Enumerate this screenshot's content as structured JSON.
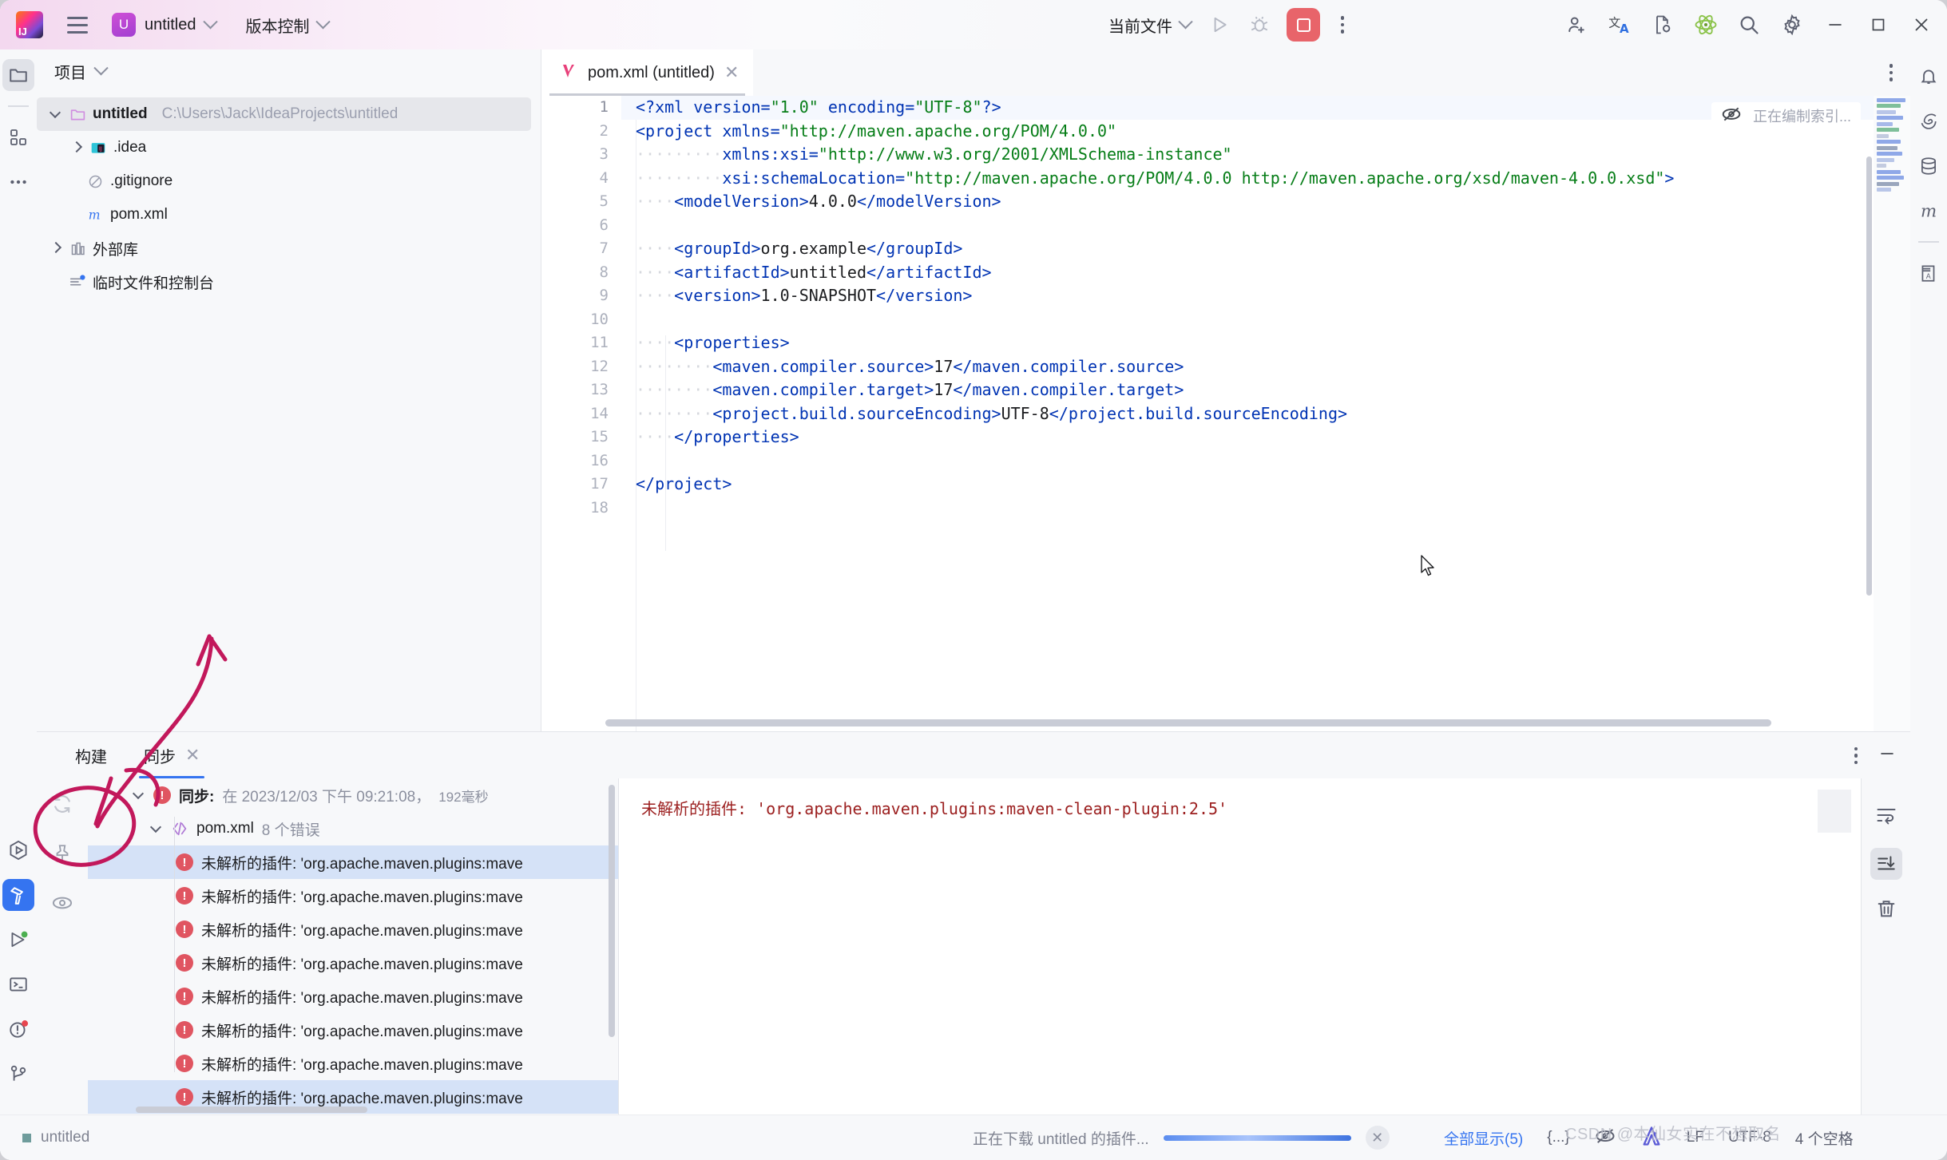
{
  "window": {
    "app_icon": "intellij-idea-logo",
    "menu_icon": "hamburger-menu-icon",
    "project_badge": "U",
    "project_name": "untitled",
    "vcs_label": "版本控制",
    "run_config": "当前文件",
    "minimize_label": "−",
    "maximize_label": "▢",
    "close_label": "✕"
  },
  "toolbar_right_icons": [
    "add-user-icon",
    "translate-icon",
    "file-settings-icon",
    "atom-plugin-icon",
    "search-icon",
    "settings-gear-icon"
  ],
  "left_activity_bar": {
    "top_items": [
      "project-folder-icon",
      "structure-icon",
      "more-icon"
    ],
    "bottom_items": [
      "run-icon",
      "build-hammer-icon",
      "run-dashboard-icon",
      "terminal-icon",
      "problems-icon",
      "git-branch-icon"
    ]
  },
  "right_activity_bar": {
    "items": [
      "notifications-bell-icon",
      "ai-assistant-icon",
      "database-icon",
      "maven-icon",
      "dictionary-icon"
    ]
  },
  "project_panel": {
    "title": "项目",
    "tree": [
      {
        "label": "untitled",
        "path": "C:\\Users\\Jack\\IdeaProjects\\untitled",
        "icon": "folder-icon",
        "state": "expanded",
        "selected": true,
        "indent": 0
      },
      {
        "label": ".idea",
        "path": "",
        "icon": "idea-folder-icon",
        "state": "collapsed",
        "selected": false,
        "indent": 1
      },
      {
        "label": ".gitignore",
        "path": "",
        "icon": "gitignore-icon",
        "state": "leaf",
        "selected": false,
        "indent": 1
      },
      {
        "label": "pom.xml",
        "path": "",
        "icon": "maven-file-icon",
        "state": "leaf",
        "selected": false,
        "indent": 1
      },
      {
        "label": "外部库",
        "path": "",
        "icon": "external-libraries-icon",
        "state": "collapsed",
        "selected": false,
        "indent": 0
      },
      {
        "label": "临时文件和控制台",
        "path": "",
        "icon": "scratches-icon",
        "state": "leaf",
        "selected": false,
        "indent": 0
      }
    ]
  },
  "editor": {
    "tab_label": "pom.xml (untitled)",
    "tab_icon": "maven-v-icon",
    "tab_close": "✕",
    "indexing_text": "正在编制索引...",
    "indexing_icon": "inspections-off-icon",
    "lines": [
      {
        "n": 1,
        "current": true,
        "tokens": [
          {
            "t": "tag",
            "s": "<?xml "
          },
          {
            "t": "attr",
            "s": "version"
          },
          {
            "t": "tag",
            "s": "="
          },
          {
            "t": "val",
            "s": "\"1.0\""
          },
          {
            "t": "txt",
            "s": " "
          },
          {
            "t": "attr",
            "s": "encoding"
          },
          {
            "t": "tag",
            "s": "="
          },
          {
            "t": "val",
            "s": "\"UTF-8\""
          },
          {
            "t": "tag",
            "s": "?>"
          }
        ]
      },
      {
        "n": 2,
        "current": false,
        "tokens": [
          {
            "t": "tag",
            "s": "<project "
          },
          {
            "t": "attr",
            "s": "xmlns"
          },
          {
            "t": "tag",
            "s": "="
          },
          {
            "t": "val",
            "s": "\"http://maven.apache.org/POM/4.0.0\""
          }
        ]
      },
      {
        "n": 3,
        "current": false,
        "tokens": [
          {
            "t": "dot",
            "s": "·········"
          },
          {
            "t": "attr",
            "s": "xmlns:xsi"
          },
          {
            "t": "tag",
            "s": "="
          },
          {
            "t": "val",
            "s": "\"http://www.w3.org/2001/XMLSchema-instance\""
          }
        ]
      },
      {
        "n": 4,
        "current": false,
        "tokens": [
          {
            "t": "dot",
            "s": "·········"
          },
          {
            "t": "attr",
            "s": "xsi:schemaLocation"
          },
          {
            "t": "tag",
            "s": "="
          },
          {
            "t": "val",
            "s": "\"http://maven.apache.org/POM/4.0.0 http://maven.apache.org/xsd/maven-4.0.0.xsd\""
          },
          {
            "t": "tag",
            "s": ">"
          }
        ]
      },
      {
        "n": 5,
        "current": false,
        "tokens": [
          {
            "t": "dot",
            "s": "····"
          },
          {
            "t": "tag",
            "s": "<modelVersion>"
          },
          {
            "t": "txt",
            "s": "4.0.0"
          },
          {
            "t": "tag",
            "s": "</modelVersion>"
          }
        ]
      },
      {
        "n": 6,
        "current": false,
        "tokens": []
      },
      {
        "n": 7,
        "current": false,
        "tokens": [
          {
            "t": "dot",
            "s": "····"
          },
          {
            "t": "tag",
            "s": "<groupId>"
          },
          {
            "t": "txt",
            "s": "org.example"
          },
          {
            "t": "tag",
            "s": "</groupId>"
          }
        ]
      },
      {
        "n": 8,
        "current": false,
        "tokens": [
          {
            "t": "dot",
            "s": "····"
          },
          {
            "t": "tag",
            "s": "<artifactId>"
          },
          {
            "t": "txt",
            "s": "untitled"
          },
          {
            "t": "tag",
            "s": "</artifactId>"
          }
        ]
      },
      {
        "n": 9,
        "current": false,
        "tokens": [
          {
            "t": "dot",
            "s": "····"
          },
          {
            "t": "tag",
            "s": "<version>"
          },
          {
            "t": "txt",
            "s": "1.0-SNAPSHOT"
          },
          {
            "t": "tag",
            "s": "</version>"
          }
        ]
      },
      {
        "n": 10,
        "current": false,
        "tokens": []
      },
      {
        "n": 11,
        "current": false,
        "tokens": [
          {
            "t": "dot",
            "s": "····"
          },
          {
            "t": "tag",
            "s": "<properties>"
          }
        ]
      },
      {
        "n": 12,
        "current": false,
        "tokens": [
          {
            "t": "dot",
            "s": "········"
          },
          {
            "t": "tag",
            "s": "<maven.compiler.source>"
          },
          {
            "t": "txt",
            "s": "17"
          },
          {
            "t": "tag",
            "s": "</maven.compiler.source>"
          }
        ]
      },
      {
        "n": 13,
        "current": false,
        "tokens": [
          {
            "t": "dot",
            "s": "········"
          },
          {
            "t": "tag",
            "s": "<maven.compiler.target>"
          },
          {
            "t": "txt",
            "s": "17"
          },
          {
            "t": "tag",
            "s": "</maven.compiler.target>"
          }
        ]
      },
      {
        "n": 14,
        "current": false,
        "tokens": [
          {
            "t": "dot",
            "s": "········"
          },
          {
            "t": "tag",
            "s": "<project.build.sourceEncoding>"
          },
          {
            "t": "txt",
            "s": "UTF-8"
          },
          {
            "t": "tag",
            "s": "</project.build.sourceEncoding>"
          }
        ]
      },
      {
        "n": 15,
        "current": false,
        "tokens": [
          {
            "t": "dot",
            "s": "····"
          },
          {
            "t": "tag",
            "s": "</properties>"
          }
        ]
      },
      {
        "n": 16,
        "current": false,
        "tokens": []
      },
      {
        "n": 17,
        "current": false,
        "tokens": [
          {
            "t": "tag",
            "s": "</project>"
          }
        ]
      },
      {
        "n": 18,
        "current": false,
        "tokens": []
      }
    ]
  },
  "build_panel": {
    "tabs": [
      {
        "label": "构建",
        "active": false,
        "closable": false
      },
      {
        "label": "同步",
        "active": true,
        "closable": true
      }
    ],
    "side_icons": [
      "refresh-icon",
      "pin-icon",
      "eye-icon"
    ],
    "right_icons": [
      "soft-wrap-icon",
      "scroll-to-end-icon",
      "trash-icon"
    ],
    "header_icons": [
      "kebab-menu-icon",
      "minimize-icon"
    ],
    "tree": [
      {
        "kind": "root",
        "icon": "error-icon",
        "label": "同步:",
        "meta": "在 2023/12/03 下午 09:21:08，",
        "duration": "192毫秒",
        "expanded": true,
        "selected": false
      },
      {
        "kind": "file",
        "icon": "xml-file-icon",
        "label": "pom.xml",
        "meta": "8 个错误",
        "expanded": true,
        "selected": false
      },
      {
        "kind": "error",
        "icon": "error-icon",
        "label": "未解析的插件: 'org.apache.maven.plugins:mave",
        "selected": true
      },
      {
        "kind": "error",
        "icon": "error-icon",
        "label": "未解析的插件: 'org.apache.maven.plugins:mave",
        "selected": false
      },
      {
        "kind": "error",
        "icon": "error-icon",
        "label": "未解析的插件: 'org.apache.maven.plugins:mave",
        "selected": false
      },
      {
        "kind": "error",
        "icon": "error-icon",
        "label": "未解析的插件: 'org.apache.maven.plugins:mave",
        "selected": false
      },
      {
        "kind": "error",
        "icon": "error-icon",
        "label": "未解析的插件: 'org.apache.maven.plugins:mave",
        "selected": false
      },
      {
        "kind": "error",
        "icon": "error-icon",
        "label": "未解析的插件: 'org.apache.maven.plugins:mave",
        "selected": false
      },
      {
        "kind": "error",
        "icon": "error-icon",
        "label": "未解析的插件: 'org.apache.maven.plugins:mave",
        "selected": false
      },
      {
        "kind": "error",
        "icon": "error-icon",
        "label": "未解析的插件: 'org.apache.maven.plugins:mave",
        "selected": false
      }
    ],
    "detail": "未解析的插件: 'org.apache.maven.plugins:maven-clean-plugin:2.5'"
  },
  "status_bar": {
    "project": "untitled",
    "progress_text": "正在下载 untitled 的插件...",
    "progress_cancel": "✕",
    "show_all": "全部显示(5)",
    "braces": "{...}",
    "inspections_icon": "inspections-off-icon",
    "ai_icon": "ai-assistant-icon",
    "line_sep": "LF",
    "encoding": "UTF-8",
    "indent": "4 个空格",
    "watermark": "CSDN @本仙女实在不想取名"
  },
  "colors": {
    "accent_blue": "#3574f0",
    "error_red": "#e05561",
    "tag_blue": "#0033b3",
    "string_green": "#067d17",
    "annotation_red": "#c2185b",
    "panel_bg": "#f7f8fa",
    "editor_bg": "#ffffff"
  }
}
